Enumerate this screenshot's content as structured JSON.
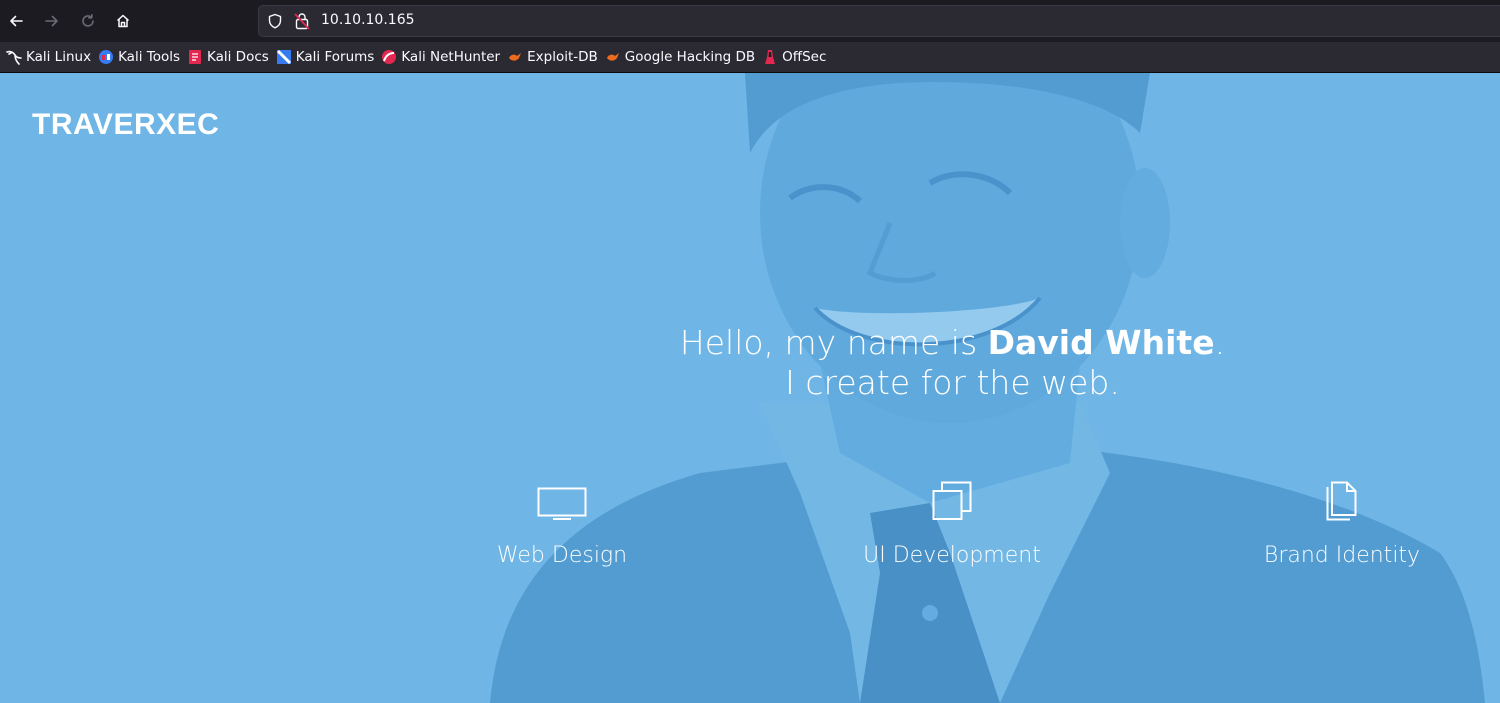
{
  "browser": {
    "url": "10.10.10.165",
    "bookmarks": [
      {
        "label": "Kali Linux",
        "icon": "kali-dragon-icon"
      },
      {
        "label": "Kali Tools",
        "icon": "kali-tools-icon"
      },
      {
        "label": "Kali Docs",
        "icon": "kali-docs-icon"
      },
      {
        "label": "Kali Forums",
        "icon": "kali-forums-icon"
      },
      {
        "label": "Kali NetHunter",
        "icon": "kali-nethunter-icon"
      },
      {
        "label": "Exploit-DB",
        "icon": "exploit-db-icon"
      },
      {
        "label": "Google Hacking DB",
        "icon": "google-hacking-db-icon"
      },
      {
        "label": "OffSec",
        "icon": "offsec-icon"
      }
    ],
    "colors": {
      "toolbar": "#1c1b22",
      "urlbar": "#2b2a33",
      "text": "#fbfbfe"
    }
  },
  "site": {
    "logo": "TRAVERXEC",
    "hero": {
      "line1_prefix": "Hello, my name is ",
      "name": "David White",
      "line1_suffix": ".",
      "line2": "I create for the web."
    },
    "services": [
      {
        "label": "Web Design",
        "icon": "monitor-icon"
      },
      {
        "label": "UI Development",
        "icon": "stacked-squares-icon"
      },
      {
        "label": "Brand Identity",
        "icon": "documents-icon"
      }
    ],
    "colors": {
      "background": "#6fb6e6",
      "text": "#ffffff"
    }
  }
}
